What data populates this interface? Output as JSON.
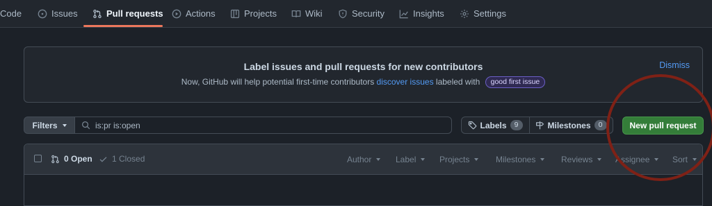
{
  "repo_nav": {
    "items": [
      {
        "label": "Code",
        "icon": "code-icon"
      },
      {
        "label": "Issues",
        "icon": "issue-icon"
      },
      {
        "label": "Pull requests",
        "icon": "pull-request-icon",
        "active": true
      },
      {
        "label": "Actions",
        "icon": "play-icon"
      },
      {
        "label": "Projects",
        "icon": "table-icon"
      },
      {
        "label": "Wiki",
        "icon": "book-icon"
      },
      {
        "label": "Security",
        "icon": "shield-icon"
      },
      {
        "label": "Insights",
        "icon": "graph-icon"
      },
      {
        "label": "Settings",
        "icon": "gear-icon"
      }
    ],
    "active_color": "#ec775c"
  },
  "banner": {
    "title": "Label issues and pull requests for new contributors",
    "desc_before": "Now, GitHub will help potential first-time contributors ",
    "desc_link": "discover issues",
    "desc_after": " labeled with",
    "badge": "good first issue",
    "dismiss": "Dismiss"
  },
  "filter_bar": {
    "filters_label": "Filters",
    "search_value": "is:pr is:open",
    "labels_label": "Labels",
    "labels_count": "9",
    "milestones_label": "Milestones",
    "milestones_count": "0",
    "new_pr_label": "New pull request",
    "new_pr_color": "#347d39"
  },
  "list_header": {
    "open_label": "0 Open",
    "closed_label": "1 Closed",
    "filters": [
      "Author",
      "Label",
      "Projects",
      "Milestones",
      "Reviews",
      "Assignee",
      "Sort"
    ]
  },
  "annotation": {
    "color": "#7f2116"
  }
}
